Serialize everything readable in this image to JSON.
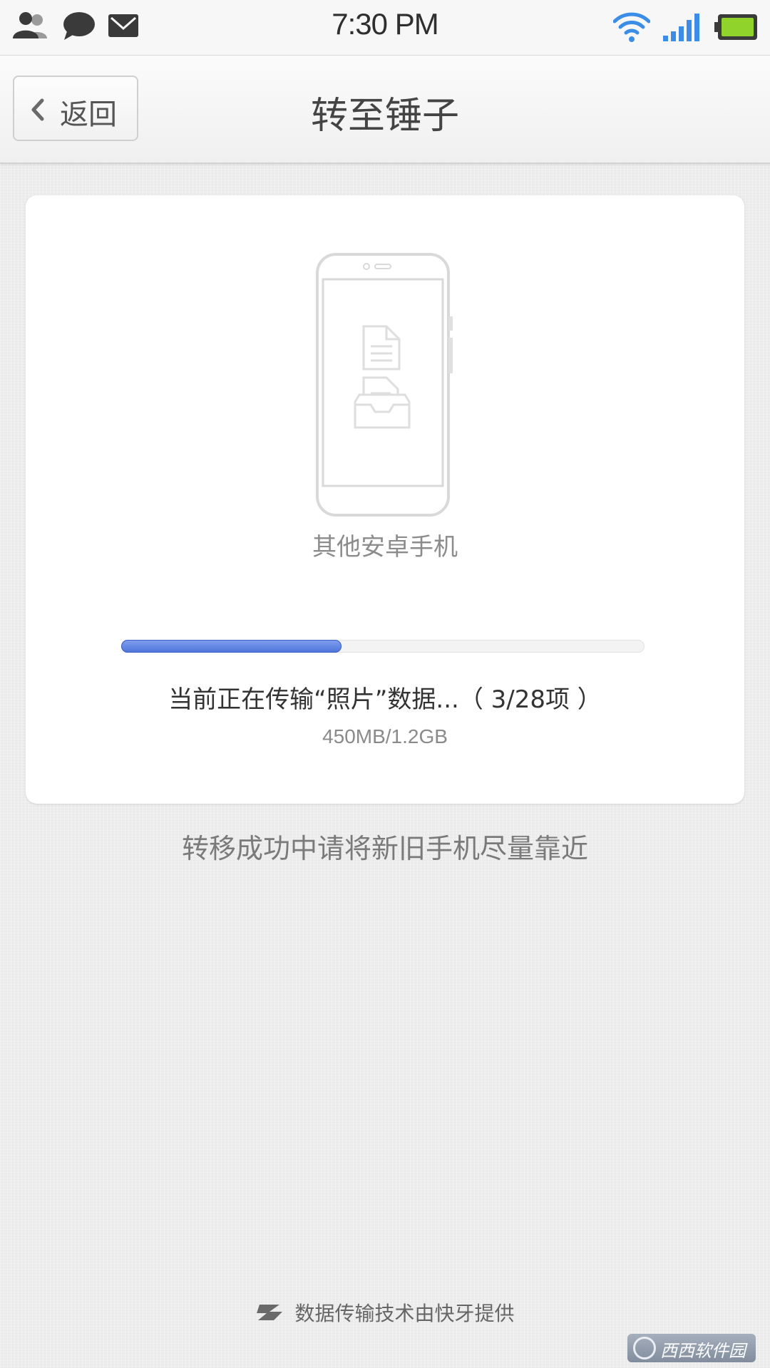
{
  "status_bar": {
    "time": "7:30 PM",
    "icons": [
      "contacts-icon",
      "message-icon",
      "mail-icon",
      "wifi-icon",
      "signal-icon",
      "battery-icon"
    ],
    "battery_color": "#8fd32b",
    "wifi_color": "#3b8de8"
  },
  "nav": {
    "back_label": "返回",
    "title": "转至锤子"
  },
  "card": {
    "device_label": "其他安卓手机",
    "progress": {
      "fraction": 0.42,
      "color": "#4d73d9"
    },
    "transfer_status": "当前正在传输“照片”数据...（ 3/28项 ）",
    "transfer_size": "450MB/1.2GB"
  },
  "hint": "转移成功中请将新旧手机尽量靠近",
  "footer": {
    "text": "数据传输技术由快牙提供"
  },
  "watermark": {
    "text": "西西软件园"
  }
}
